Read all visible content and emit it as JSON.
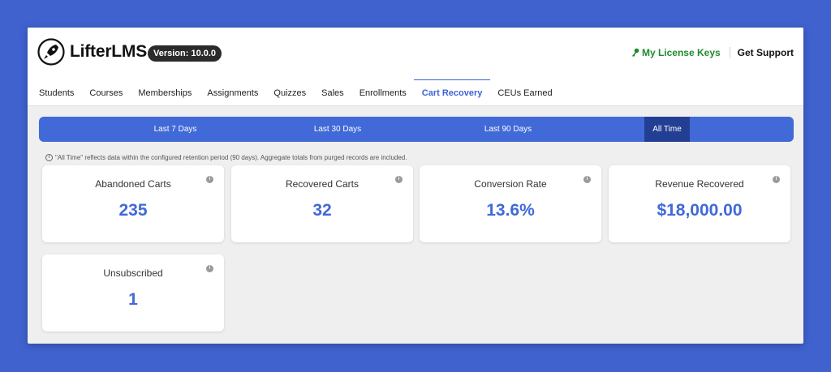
{
  "brand": {
    "name": "LifterLMS",
    "version": "Version: 10.0.0"
  },
  "header_links": {
    "license": "My License Keys",
    "support": "Get Support"
  },
  "tabs": [
    "Students",
    "Courses",
    "Memberships",
    "Assignments",
    "Quizzes",
    "Sales",
    "Enrollments",
    "Cart Recovery",
    "CEUs Earned"
  ],
  "active_tab": "Cart Recovery",
  "ranges": [
    "Last 7 Days",
    "Last 30 Days",
    "Last 90 Days",
    "All Time"
  ],
  "active_range": "All Time",
  "note": "\"All Time\" reflects data within the configured retention period (90 days). Aggregate totals from purged records are included.",
  "cards": [
    {
      "title": "Abandoned Carts",
      "value": "235"
    },
    {
      "title": "Recovered Carts",
      "value": "32"
    },
    {
      "title": "Conversion Rate",
      "value": "13.6%"
    },
    {
      "title": "Revenue Recovered",
      "value": "$18,000.00"
    },
    {
      "title": "Unsubscribed",
      "value": "1"
    }
  ],
  "icons": {
    "info": "i"
  },
  "colors": {
    "accent": "#4169d8",
    "active_range": "#233f93",
    "license": "#1e8b2b",
    "background": "#3f62cf"
  }
}
